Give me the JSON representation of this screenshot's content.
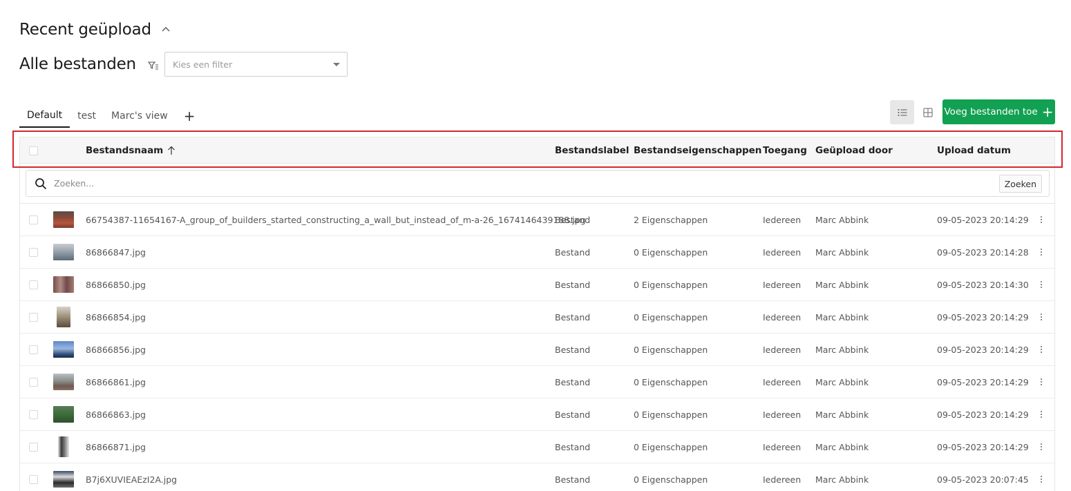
{
  "header": {
    "recent_title": "Recent geüpload",
    "all_title": "Alle bestanden",
    "filter_placeholder": "Kies een filter"
  },
  "tabs": [
    {
      "label": "Default",
      "active": true
    },
    {
      "label": "test",
      "active": false
    },
    {
      "label": "Marc's view",
      "active": false
    }
  ],
  "tab_add_label": "+",
  "toolbar": {
    "add_files_label": "Voeg bestanden toe",
    "add_files_icon": "+",
    "accent_color": "#12a052"
  },
  "table": {
    "columns": {
      "name": "Bestandsnaam",
      "label": "Bestandslabel",
      "properties": "Bestandseigenschappen",
      "access": "Toegang",
      "uploaded_by": "Geüpload door",
      "upload_date": "Upload datum"
    },
    "sort": {
      "column": "Bestandsnaam",
      "direction": "ascending"
    },
    "search_placeholder": "Zoeken...",
    "search_button": "Zoeken",
    "rows": [
      {
        "name": "66754387-11654167-A_group_of_builders_started_constructing_a_wall_but_instead_of_m-a-26_1674146439188.jpg",
        "label": "Bestand",
        "properties": "2 Eigenschappen",
        "access": "Iedereen",
        "uploaded_by": "Marc Abbink",
        "date": "09-05-2023 20:14:29",
        "thumb": "bricks"
      },
      {
        "name": "86866847.jpg",
        "label": "Bestand",
        "properties": "0 Eigenschappen",
        "access": "Iedereen",
        "uploaded_by": "Marc Abbink",
        "date": "09-05-2023 20:14:28",
        "thumb": "room"
      },
      {
        "name": "86866850.jpg",
        "label": "Bestand",
        "properties": "0 Eigenschappen",
        "access": "Iedereen",
        "uploaded_by": "Marc Abbink",
        "date": "09-05-2023 20:14:30",
        "thumb": "facade"
      },
      {
        "name": "86866854.jpg",
        "label": "Bestand",
        "properties": "0 Eigenschappen",
        "access": "Iedereen",
        "uploaded_by": "Marc Abbink",
        "date": "09-05-2023 20:14:29",
        "thumb": "interior"
      },
      {
        "name": "86866856.jpg",
        "label": "Bestand",
        "properties": "0 Eigenschappen",
        "access": "Iedereen",
        "uploaded_by": "Marc Abbink",
        "date": "09-05-2023 20:14:29",
        "thumb": "sky"
      },
      {
        "name": "86866861.jpg",
        "label": "Bestand",
        "properties": "0 Eigenschappen",
        "access": "Iedereen",
        "uploaded_by": "Marc Abbink",
        "date": "09-05-2023 20:14:29",
        "thumb": "street"
      },
      {
        "name": "86866863.jpg",
        "label": "Bestand",
        "properties": "0 Eigenschappen",
        "access": "Iedereen",
        "uploaded_by": "Marc Abbink",
        "date": "09-05-2023 20:14:29",
        "thumb": "green"
      },
      {
        "name": "86866871.jpg",
        "label": "Bestand",
        "properties": "0 Eigenschappen",
        "access": "Iedereen",
        "uploaded_by": "Marc Abbink",
        "date": "09-05-2023 20:14:29",
        "thumb": "door"
      },
      {
        "name": "B7j6XUVIEAEzI2A.jpg",
        "label": "Bestand",
        "properties": "0 Eigenschappen",
        "access": "Iedereen",
        "uploaded_by": "Marc Abbink",
        "date": "09-05-2023 20:07:45",
        "thumb": "sign"
      }
    ]
  }
}
